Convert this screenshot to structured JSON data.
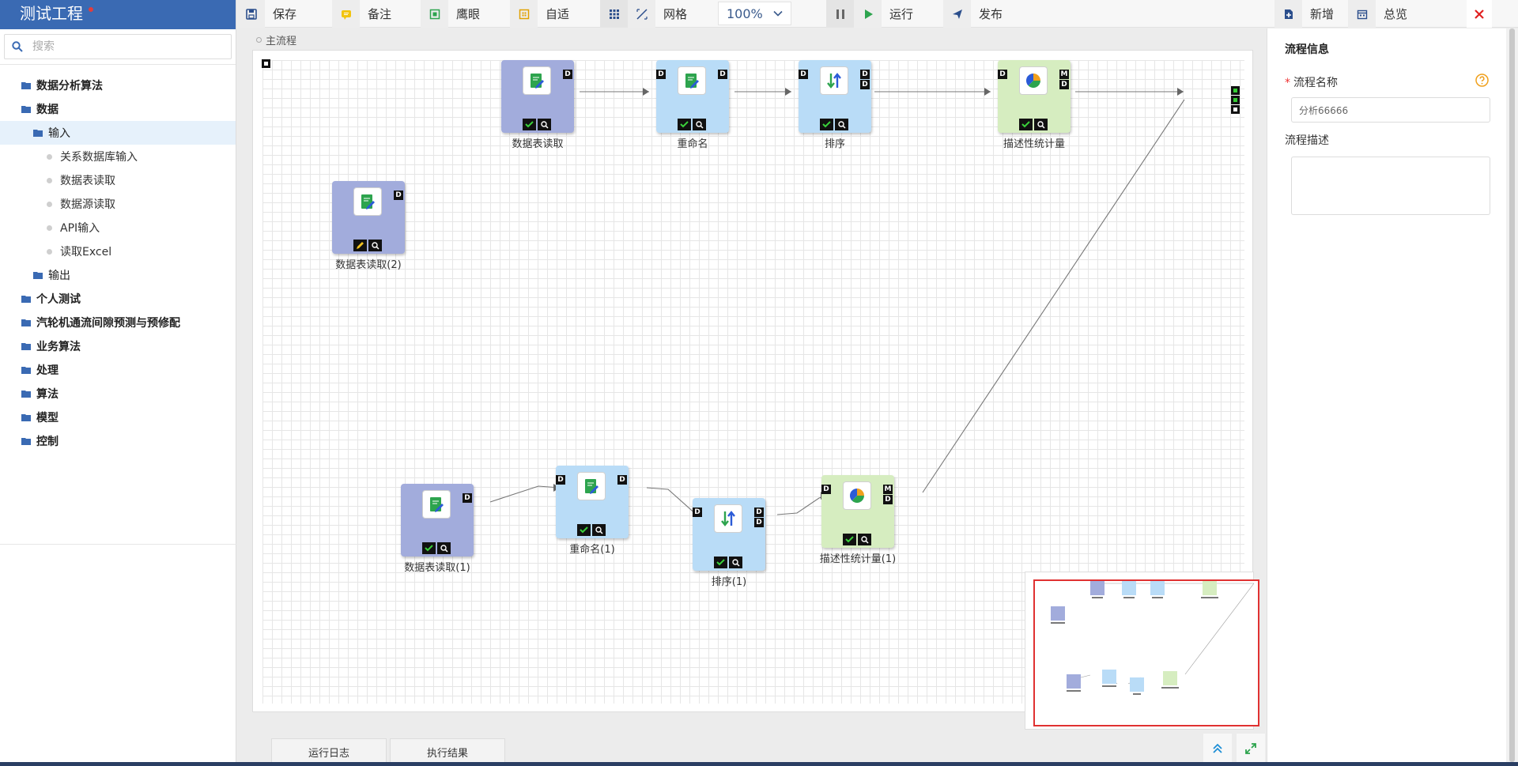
{
  "app": {
    "title": "测试工程"
  },
  "search": {
    "placeholder": "搜索"
  },
  "tree": {
    "items": [
      {
        "label": "数据分析算法"
      },
      {
        "label": "数据"
      },
      {
        "label": "输入"
      },
      {
        "label": "关系数据库输入"
      },
      {
        "label": "数据表读取"
      },
      {
        "label": "数据源读取"
      },
      {
        "label": "API输入"
      },
      {
        "label": "读取Excel"
      },
      {
        "label": "输出"
      },
      {
        "label": "个人测试"
      },
      {
        "label": "汽轮机通流间隙预测与预修配"
      },
      {
        "label": "业务算法"
      },
      {
        "label": "处理"
      },
      {
        "label": "算法"
      },
      {
        "label": "模型"
      },
      {
        "label": "控制"
      }
    ]
  },
  "toolbar": {
    "save": "保存",
    "note": "备注",
    "eagle_eye": "鹰眼",
    "fit": "自适",
    "grid": "网格",
    "zoom": "100%",
    "run": "运行",
    "publish": "发布",
    "add": "新增",
    "overview": "总览"
  },
  "canvas": {
    "breadcrumb": "主流程",
    "nodes": [
      {
        "label": "数据表读取"
      },
      {
        "label": "重命名"
      },
      {
        "label": "排序"
      },
      {
        "label": "描述性统计量"
      },
      {
        "label": "数据表读取(2)"
      },
      {
        "label": "数据表读取(1)"
      },
      {
        "label": "重命名(1)"
      },
      {
        "label": "排序(1)"
      },
      {
        "label": "描述性统计量(1)"
      }
    ],
    "port_labels": {
      "data": "D",
      "model": "M"
    }
  },
  "bottom_tabs": {
    "log": "运行日志",
    "result": "执行结果"
  },
  "right_panel": {
    "title": "流程信息",
    "name_label": "流程名称",
    "name_value": "分析66666",
    "desc_label": "流程描述"
  },
  "colors": {
    "header_blue": "#3a6ab3",
    "node_purple": "#a2acdc",
    "node_blue": "#b9dcf7",
    "node_green": "#d6edc0",
    "minimap_border": "#e03131"
  }
}
